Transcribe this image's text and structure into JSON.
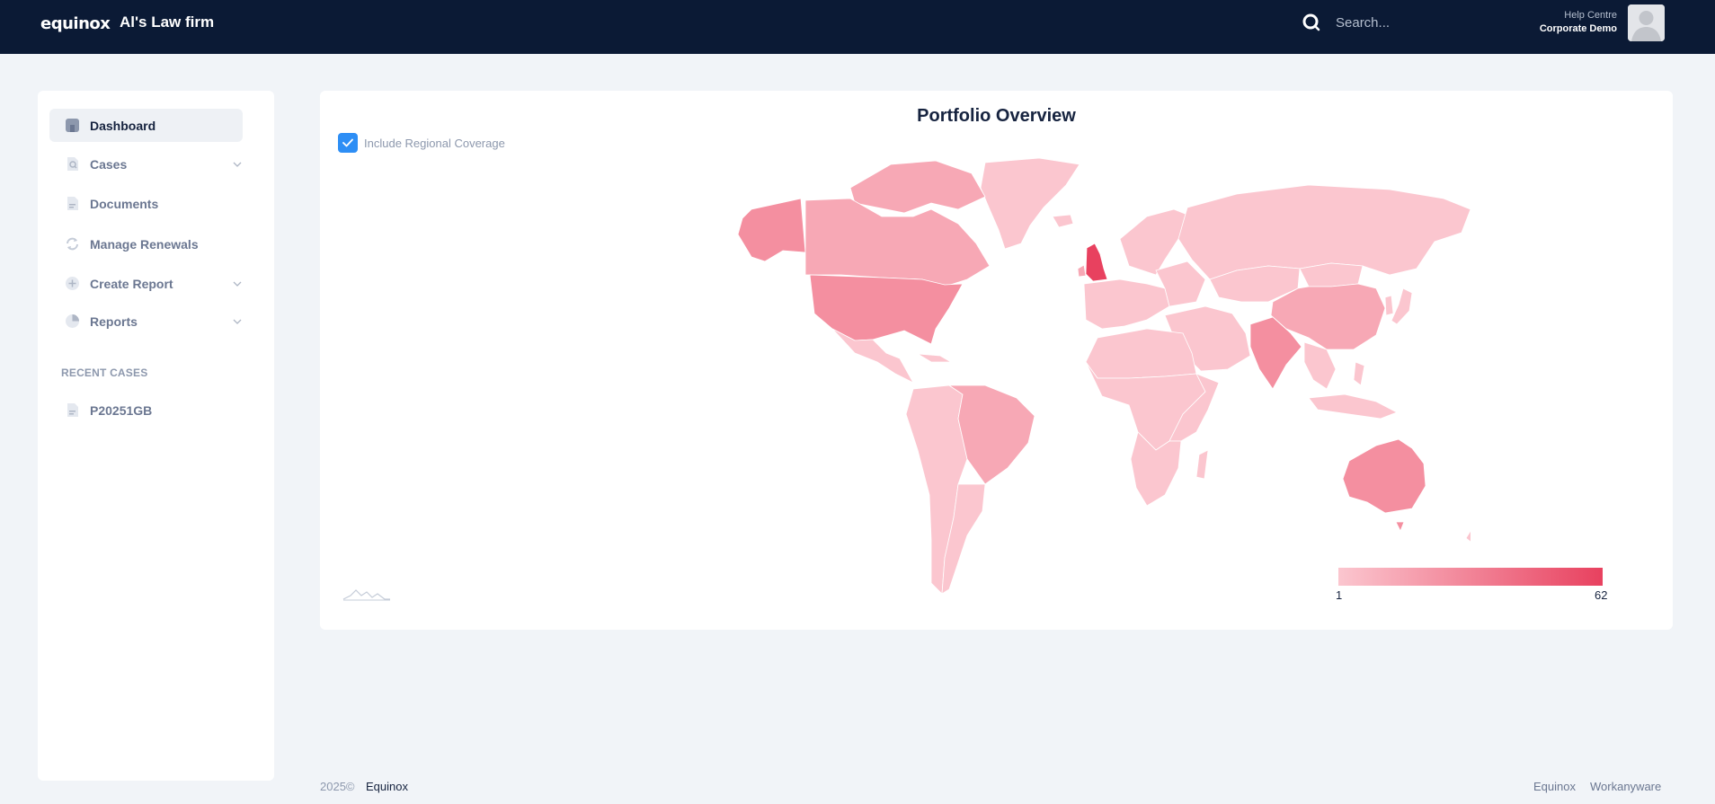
{
  "header": {
    "logo_text": "equinox",
    "firm_name": "Al's Law firm",
    "search_placeholder": "Search...",
    "help_label": "Help Centre",
    "account_label": "Corporate Demo"
  },
  "sidebar": {
    "items": [
      {
        "label": "Dashboard",
        "icon": "dashboard-icon",
        "active": true,
        "expandable": false
      },
      {
        "label": "Cases",
        "icon": "case-search-icon",
        "active": false,
        "expandable": true
      },
      {
        "label": "Documents",
        "icon": "document-icon",
        "active": false,
        "expandable": false
      },
      {
        "label": "Manage Renewals",
        "icon": "refresh-icon",
        "active": false,
        "expandable": false
      },
      {
        "label": "Create Report",
        "icon": "plus-circle-icon",
        "active": false,
        "expandable": true
      },
      {
        "label": "Reports",
        "icon": "pie-chart-icon",
        "active": false,
        "expandable": true
      }
    ],
    "recent_title": "RECENT CASES",
    "recent_cases": [
      {
        "label": "P20251GB",
        "icon": "document-icon"
      }
    ]
  },
  "main": {
    "title": "Portfolio Overview",
    "include_regional_label": "Include Regional Coverage",
    "include_regional_checked": true,
    "legend": {
      "min": "1",
      "max": "62",
      "color_low": "#fbc6cf",
      "color_high": "#e8415f"
    }
  },
  "footer": {
    "year": "2025©",
    "brand": "Equinox",
    "links": [
      "Equinox",
      "Workanyware"
    ]
  },
  "colors": {
    "header_bg": "#0b1a35",
    "accent": "#2d8ef5",
    "page_bg": "#f1f4f8"
  }
}
